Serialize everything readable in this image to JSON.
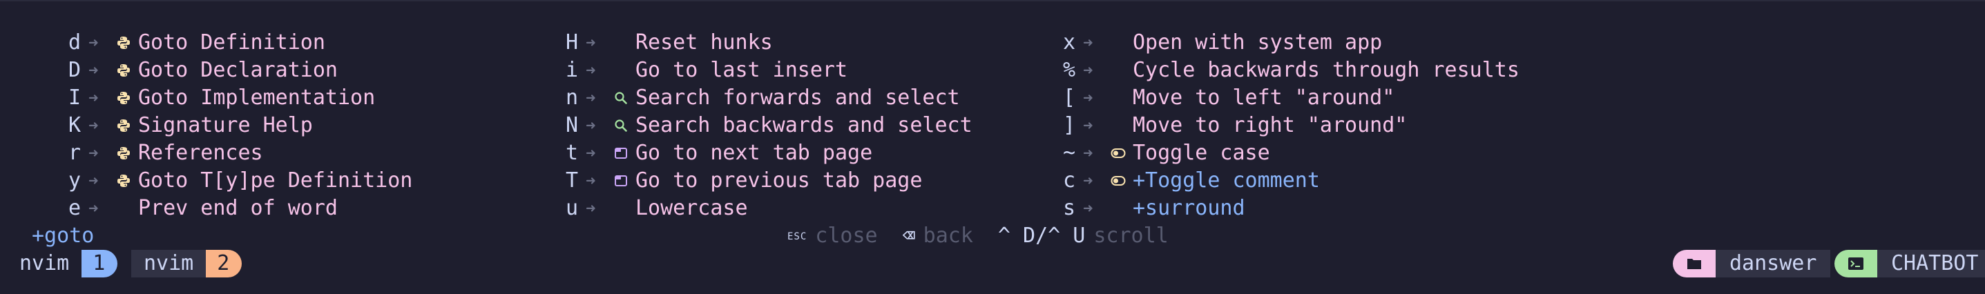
{
  "colors": {
    "background": "#1e1e2e",
    "key": "#cdd6f4",
    "arrow": "#6c7086",
    "description": "#f5c2e7",
    "group": "#89b4fa",
    "python_icon": "#f9e2af",
    "search_icon": "#a6e3a1",
    "tab_icon": "#cba6f7",
    "toggle_icon": "#f9e2af",
    "hint_label": "#585b70",
    "window_1": "#89b4fa",
    "window_2": "#fab387",
    "session": "#f5c2e7",
    "terminal": "#a6e3a1"
  },
  "menu": {
    "arrow": "➜",
    "columns": [
      {
        "rows": [
          {
            "key": "d",
            "icon": "python-icon",
            "desc": "Goto Definition"
          },
          {
            "key": "D",
            "icon": "python-icon",
            "desc": "Goto Declaration"
          },
          {
            "key": "I",
            "icon": "python-icon",
            "desc": "Goto Implementation"
          },
          {
            "key": "K",
            "icon": "python-icon",
            "desc": "Signature Help"
          },
          {
            "key": "r",
            "icon": "python-icon",
            "desc": "References"
          },
          {
            "key": "y",
            "icon": "python-icon",
            "desc": "Goto T[y]pe Definition"
          },
          {
            "key": "e",
            "icon": "",
            "desc": "Prev end of word"
          }
        ]
      },
      {
        "rows": [
          {
            "key": "H",
            "icon": "",
            "desc": "Reset hunks"
          },
          {
            "key": "i",
            "icon": "",
            "desc": "Go to last insert"
          },
          {
            "key": "n",
            "icon": "search-icon",
            "desc": "Search forwards and select"
          },
          {
            "key": "N",
            "icon": "search-icon",
            "desc": "Search backwards and select"
          },
          {
            "key": "t",
            "icon": "tab-icon",
            "desc": "Go to next tab page"
          },
          {
            "key": "T",
            "icon": "tab-icon",
            "desc": "Go to previous tab page"
          },
          {
            "key": "u",
            "icon": "",
            "desc": "Lowercase"
          }
        ]
      },
      {
        "rows": [
          {
            "key": "x",
            "icon": "",
            "desc": "Open with system app"
          },
          {
            "key": "%",
            "icon": "",
            "desc": "Cycle backwards through results"
          },
          {
            "key": "[",
            "icon": "",
            "desc": "Move to left \"around\""
          },
          {
            "key": "]",
            "icon": "",
            "desc": "Move to right \"around\""
          },
          {
            "key": "~",
            "icon": "toggle-icon",
            "desc": "Toggle case"
          },
          {
            "key": "c",
            "icon": "toggle-icon",
            "desc": "+Toggle comment",
            "group": true
          },
          {
            "key": "s",
            "icon": "",
            "desc": "+surround",
            "group": true
          }
        ]
      }
    ]
  },
  "breadcrumb": "+goto",
  "hints": [
    {
      "key": "ESC",
      "small": true,
      "label": "close"
    },
    {
      "key": "⌫",
      "small": false,
      "label": "back"
    },
    {
      "key": "^ D/^ U",
      "small": false,
      "label": "scroll"
    }
  ],
  "statusbar": {
    "windows": [
      {
        "name": "nvim",
        "index": "1"
      },
      {
        "name": "nvim",
        "index": "2"
      }
    ],
    "session": {
      "icon": "folder-icon",
      "label": "danswer"
    },
    "host": {
      "icon": "terminal-icon",
      "label": "CHATBOT"
    }
  }
}
